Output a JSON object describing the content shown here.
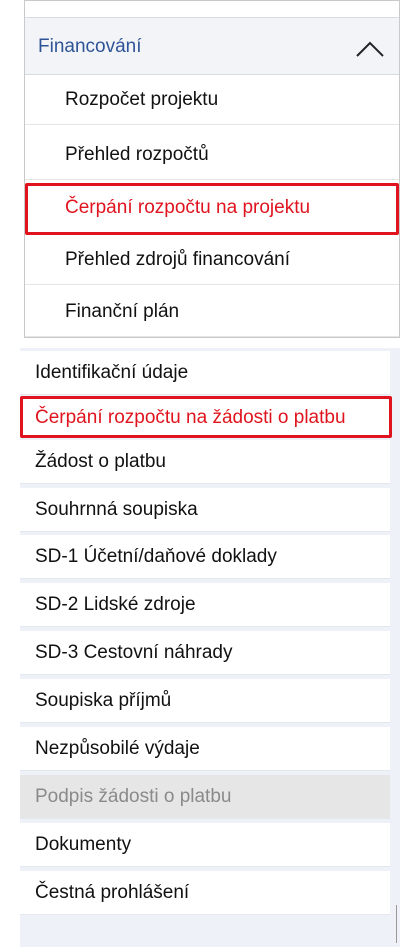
{
  "financing_menu": {
    "title": "Financování",
    "items": [
      {
        "label": "Rozpočet projektu"
      },
      {
        "label": "Přehled rozpočtů"
      },
      {
        "label": "Čerpání rozpočtu na projektu",
        "highlighted": true
      },
      {
        "label": "Přehled zdrojů financování"
      },
      {
        "label": "Finanční plán"
      }
    ]
  },
  "request_menu": {
    "items": [
      {
        "label": "Identifikační údaje"
      },
      {
        "label": "Čerpání rozpočtu na žádosti o platbu",
        "highlighted": true
      },
      {
        "label": "Žádost o platbu"
      },
      {
        "label": "Souhrnná soupiska"
      },
      {
        "label": "SD-1 Účetní/daňové doklady"
      },
      {
        "label": "SD-2 Lidské zdroje"
      },
      {
        "label": "SD-3 Cestovní náhrady"
      },
      {
        "label": "Soupiska příjmů"
      },
      {
        "label": "Nezpůsobilé výdaje"
      },
      {
        "label": "Podpis žádosti o platbu",
        "disabled": true
      },
      {
        "label": "Dokumenty"
      },
      {
        "label": "Čestná prohlášení"
      }
    ]
  },
  "colors": {
    "highlight": "#e0141e",
    "section_title": "#2f5496",
    "disabled_bg": "#e6e6e6"
  },
  "icons": {
    "collapse": "chevron-up-icon"
  }
}
